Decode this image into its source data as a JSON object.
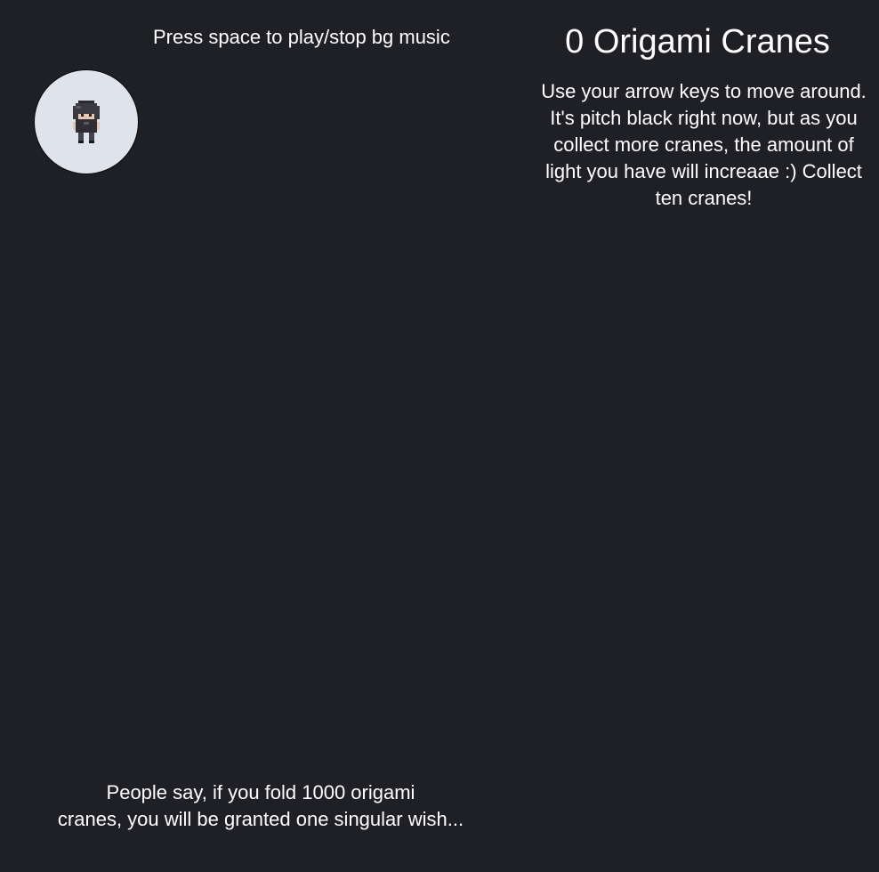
{
  "hud": {
    "music_hint": "Press space to play/stop bg music",
    "crane_count": "0",
    "crane_label": "Origami Cranes",
    "instructions": "Use your arrow keys to move around. It's pitch black right now, but as you collect more cranes, the amount of light you have will increaae :) Collect ten cranes!"
  },
  "lore": {
    "line1": "People say, if you fold 1000 origami",
    "line2": "cranes, you will be granted one singular wish..."
  },
  "player": {
    "sprite": "player-character-icon"
  },
  "colors": {
    "background": "#1f1f26",
    "light": "#dfe3ec",
    "text": "#ffffff"
  }
}
